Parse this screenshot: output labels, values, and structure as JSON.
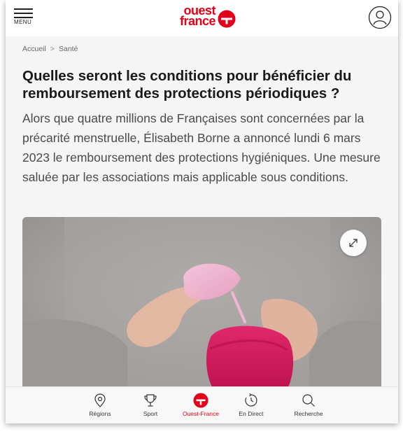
{
  "header": {
    "menu_label": "MENU",
    "logo_line1": "ouest",
    "logo_line2": "france"
  },
  "breadcrumb": {
    "items": [
      "Accueil",
      "Santé"
    ],
    "separator": ">"
  },
  "article": {
    "title": "Quelles seront les conditions pour bénéficier du remboursement des protections périodiques ?",
    "lead": "Alors que quatre millions de Françaises sont concernées par la précarité menstruelle, Élisabeth Borne a annoncé lundi 6 mars 2023 le remboursement des protections hygiéniques. Une mesure saluée par les associations mais applicable sous conditions."
  },
  "bottom_nav": {
    "items": [
      {
        "label": "Régions",
        "icon": "location-pin-icon"
      },
      {
        "label": "Sport",
        "icon": "trophy-icon"
      },
      {
        "label": "Ouest-France",
        "icon": "ouest-france-logo-icon",
        "active": true
      },
      {
        "label": "En Direct",
        "icon": "clock-arrow-icon"
      },
      {
        "label": "Recherche",
        "icon": "search-icon"
      }
    ]
  },
  "colors": {
    "brand_red": "#e2001a",
    "text_dark": "#1a1a1a",
    "text_lead": "#4a4a4a",
    "background": "#f5f5f5"
  }
}
